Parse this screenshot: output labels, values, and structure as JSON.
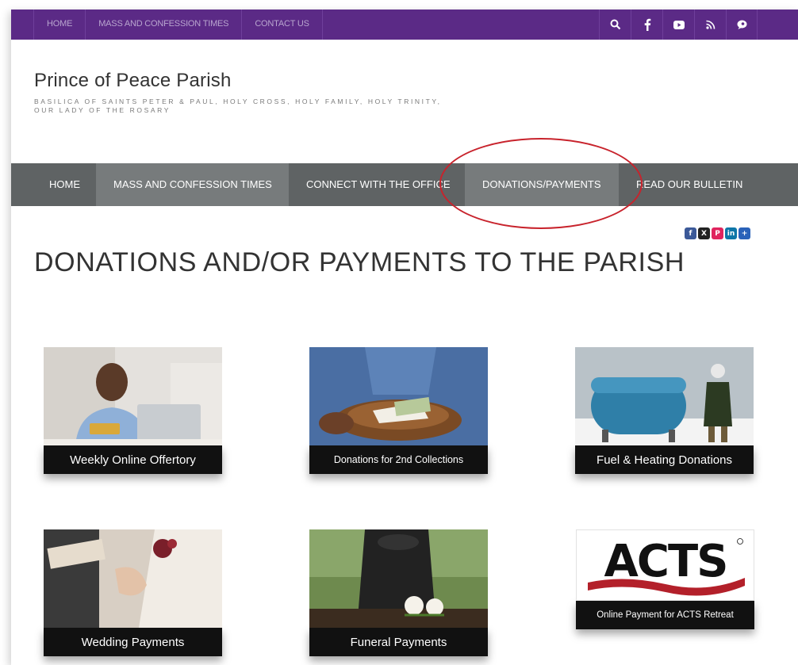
{
  "topbar": {
    "links": [
      "HOME",
      "MASS AND CONFESSION TIMES",
      "CONTACT US"
    ],
    "icons": [
      "search-icon",
      "facebook-icon",
      "youtube-icon",
      "rss-icon",
      "chat-icon"
    ]
  },
  "site": {
    "title": "Prince of Peace Parish",
    "tagline": "BASILICA OF SAINTS PETER & PAUL, HOLY CROSS, HOLY FAMILY, HOLY TRINITY, OUR LADY OF THE ROSARY"
  },
  "nav": {
    "items": [
      "HOME",
      "MASS AND CONFESSION TIMES",
      "CONNECT WITH THE OFFICE",
      "DONATIONS/PAYMENTS",
      "READ OUR BULLETIN"
    ]
  },
  "share": {
    "icons": [
      "facebook-icon",
      "x-icon",
      "pinterest-icon",
      "linkedin-icon",
      "plus-icon"
    ]
  },
  "page": {
    "title": "DONATIONS AND/OR PAYMENTS TO THE PARISH"
  },
  "tiles": [
    {
      "label": "Weekly Online Offertory"
    },
    {
      "label": "Donations for 2nd Collections"
    },
    {
      "label": "Fuel & Heating Donations"
    },
    {
      "label": "Wedding Payments"
    },
    {
      "label": "Funeral Payments"
    },
    {
      "label": "Online Payment for ACTS Retreat",
      "logo_text": "ACTS"
    }
  ],
  "colors": {
    "topbar": "#5b2a86",
    "nav": "#5f6364",
    "nav_active": "#777b7c",
    "highlight_circle": "#c8232c"
  }
}
